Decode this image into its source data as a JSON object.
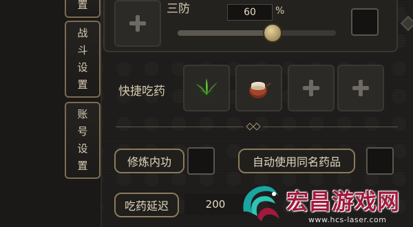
{
  "tabs": {
    "partial_label": "置",
    "combat_settings": [
      "战",
      "斗",
      "设",
      "置"
    ],
    "account_settings": [
      "账",
      "号",
      "设",
      "置"
    ]
  },
  "defense": {
    "label": "三防",
    "value": "60",
    "unit": "%",
    "slider_level": 0.6
  },
  "quick_medicine": {
    "label": "快捷吃药",
    "slots": [
      "herb-icon",
      "medicine-pot-icon",
      "empty-plus-icon",
      "empty-plus-icon"
    ]
  },
  "options": {
    "cultivate_inner_skill": "修炼内功",
    "auto_use_same_medicine": "自动使用同名药品"
  },
  "medicine_delay": {
    "label": "吃药延迟",
    "value": "200"
  },
  "watermark": {
    "title": "宏昌游戏网",
    "url": "www.hcs-laser.com"
  },
  "colors": {
    "accent_gold": "#8c7b5c",
    "watermark_red": "#a3183d",
    "watermark_teal": "#19a6a0"
  }
}
